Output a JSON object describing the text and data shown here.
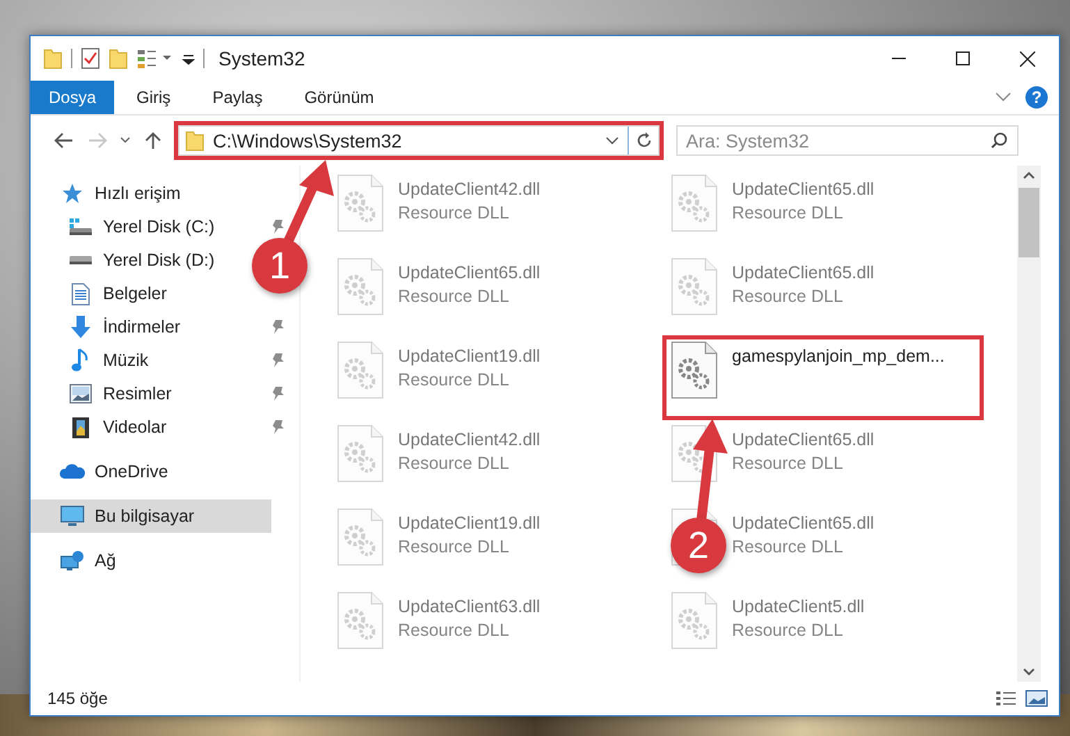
{
  "window": {
    "title": "System32"
  },
  "ribbon": {
    "tabs": [
      {
        "label": "Dosya",
        "kind": "file"
      },
      {
        "label": "Giriş",
        "kind": "tab"
      },
      {
        "label": "Paylaş",
        "kind": "tab"
      },
      {
        "label": "Görünüm",
        "kind": "tab"
      }
    ],
    "help": "?"
  },
  "navigation": {
    "back_disabled": false,
    "forward_disabled": true
  },
  "address": {
    "path": "C:\\Windows\\System32",
    "highlighted": true
  },
  "search": {
    "placeholder": "Ara: System32"
  },
  "sidebar": {
    "items": [
      {
        "label": "Hızlı erişim",
        "kind": "star",
        "selected": false,
        "children": [
          {
            "label": "Yerel Disk (C:)",
            "kind": "system-disk",
            "pinned": true,
            "selected": false
          },
          {
            "label": "Yerel Disk (D:)",
            "kind": "disk",
            "pinned": false,
            "selected": false
          },
          {
            "label": "Belgeler",
            "kind": "document",
            "pinned": false,
            "selected": false
          },
          {
            "label": "İndirmeler",
            "kind": "download",
            "pinned": true,
            "selected": false
          },
          {
            "label": "Müzik",
            "kind": "music",
            "pinned": true,
            "selected": false
          },
          {
            "label": "Resimler",
            "kind": "picture",
            "pinned": true,
            "selected": false
          },
          {
            "label": "Videolar",
            "kind": "video",
            "pinned": true,
            "selected": false
          }
        ]
      },
      {
        "label": "OneDrive",
        "kind": "cloud",
        "selected": false
      },
      {
        "label": "Bu bilgisayar",
        "kind": "computer",
        "selected": true
      },
      {
        "label": "Ağ",
        "kind": "network",
        "selected": false
      }
    ]
  },
  "files": [
    {
      "name": "UpdateClient42.dll",
      "type": "Resource DLL",
      "blurred": true,
      "highlighted": false
    },
    {
      "name": "UpdateClient65.dll",
      "type": "Resource DLL",
      "blurred": true,
      "highlighted": false
    },
    {
      "name": "UpdateClient65.dll",
      "type": "Resource DLL",
      "blurred": true,
      "highlighted": false
    },
    {
      "name": "UpdateClient65.dll",
      "type": "Resource DLL",
      "blurred": true,
      "highlighted": false
    },
    {
      "name": "UpdateClient19.dll",
      "type": "Resource DLL",
      "blurred": true,
      "highlighted": false
    },
    {
      "name": "gamespylanjoin_mp_dem...",
      "blurred": false,
      "highlighted": true
    },
    {
      "name": "UpdateClient42.dll",
      "type": "Resource DLL",
      "blurred": true,
      "highlighted": false
    },
    {
      "name": "UpdateClient65.dll",
      "type": "Resource DLL",
      "blurred": true,
      "highlighted": false
    },
    {
      "name": "UpdateClient19.dll",
      "type": "Resource DLL",
      "blurred": true,
      "highlighted": false
    },
    {
      "name": "UpdateClient65.dll",
      "type": "Resource DLL",
      "blurred": true,
      "highlighted": false
    },
    {
      "name": "UpdateClient63.dll",
      "type": "Resource DLL",
      "blurred": true,
      "highlighted": false
    },
    {
      "name": "UpdateClient5.dll",
      "type": "Resource DLL",
      "blurred": true,
      "highlighted": false
    }
  ],
  "status_bar": {
    "count": "145 öğe"
  },
  "annotations": [
    {
      "label": "1"
    },
    {
      "label": "2"
    }
  ]
}
